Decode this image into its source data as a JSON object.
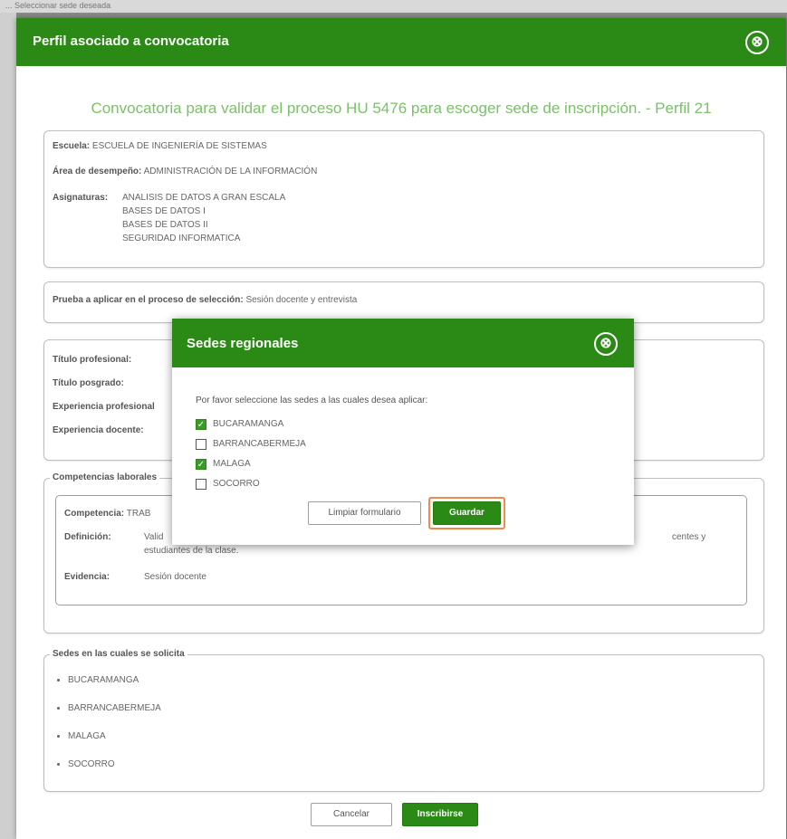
{
  "background": {
    "strip_text": "... Seleccionar sede deseada"
  },
  "modal": {
    "title": "Perfil asociado a convocatoria",
    "close_symbol": "⊗",
    "heading": "Convocatoria para validar el proceso HU 5476 para escoger sede de inscripción. - Perfil 21",
    "info": {
      "escuela_label": "Escuela:",
      "escuela_value": "ESCUELA DE INGENIERÍA DE SISTEMAS",
      "area_label": "Área de desempeño:",
      "area_value": "ADMINISTRACIÓN DE LA INFORMACIÓN",
      "asignaturas_label": "Asignaturas:",
      "asignaturas": [
        "ANALISIS DE DATOS A GRAN ESCALA",
        "BASES DE DATOS I",
        "BASES DE DATOS II",
        "SEGURIDAD INFORMATICA"
      ]
    },
    "prueba": {
      "label": "Prueba a aplicar en el proceso de selección:",
      "value": "Sesión docente y entrevista"
    },
    "requisitos": {
      "titulo_profesional": "Título profesional:",
      "titulo_posgrado": "Título posgrado:",
      "experiencia_profesional": "Experiencia profesional",
      "experiencia_docente": "Experiencia docente:"
    },
    "competencias": {
      "legend": "Competencias laborales",
      "competencia_label": "Competencia:",
      "competencia_value": "TRAB",
      "definicion_label": "Definición:",
      "definicion_value_start": "Valid",
      "definicion_value_end": "centes y",
      "definicion_value_line2": "estudiantes de la clase.",
      "evidencia_label": "Evidencia:",
      "evidencia_value": "Sesión docente"
    },
    "sedes": {
      "legend": "Sedes en las cuales se solicita",
      "items": [
        "BUCARAMANGA",
        "BARRANCABERMEJA",
        "MALAGA",
        "SOCORRO"
      ]
    },
    "buttons": {
      "cancel": "Cancelar",
      "submit": "Inscribirse"
    }
  },
  "dialog": {
    "title": "Sedes regionales",
    "close_symbol": "⊗",
    "prompt": "Por favor seleccione las sedes a las cuales desea aplicar:",
    "options": [
      {
        "label": "BUCARAMANGA",
        "checked": true
      },
      {
        "label": "BARRANCABERMEJA",
        "checked": false
      },
      {
        "label": "MALAGA",
        "checked": true
      },
      {
        "label": "SOCORRO",
        "checked": false
      }
    ],
    "buttons": {
      "clear": "Limpiar formulario",
      "save": "Guardar"
    },
    "check_mark": "✓"
  },
  "colors": {
    "primary_green": "#2a8a15",
    "heading_green": "#7ac16a",
    "highlight": "#f08a4b"
  }
}
